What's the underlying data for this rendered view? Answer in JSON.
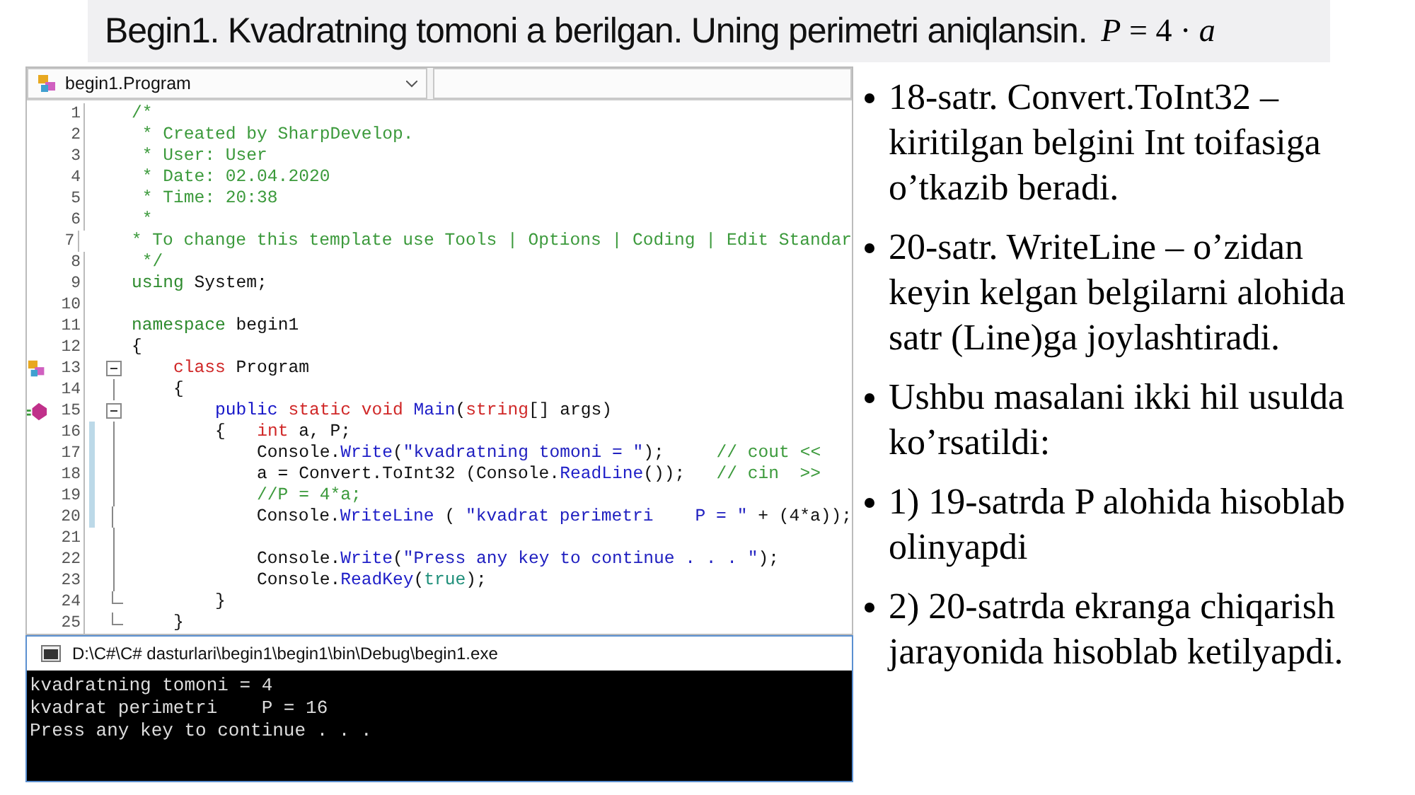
{
  "slide_title": {
    "text": "Begin1. Kvadratning tomoni a berilgan. Uning perimetri aniqlansin.",
    "formula": "*P* = 4 · *a*"
  },
  "editor": {
    "class_selector": "begin1.Program",
    "lines": [
      {
        "number": "1",
        "changed": false,
        "tokens": [
          {
            "kind": "comment",
            "text": "/*"
          }
        ]
      },
      {
        "number": "2",
        "changed": false,
        "tokens": [
          {
            "kind": "comment",
            "text": " * Created by SharpDevelop."
          }
        ]
      },
      {
        "number": "3",
        "changed": false,
        "tokens": [
          {
            "kind": "comment",
            "text": " * User: User"
          }
        ]
      },
      {
        "number": "4",
        "changed": false,
        "tokens": [
          {
            "kind": "comment",
            "text": " * Date: 02.04.2020"
          }
        ]
      },
      {
        "number": "5",
        "changed": false,
        "tokens": [
          {
            "kind": "comment",
            "text": " * Time: 20:38"
          }
        ]
      },
      {
        "number": "6",
        "changed": false,
        "tokens": [
          {
            "kind": "comment",
            "text": " *"
          }
        ]
      },
      {
        "number": "7",
        "changed": false,
        "tokens": [
          {
            "kind": "comment",
            "text": " * To change this template use Tools | Options | Coding | Edit Standar"
          }
        ]
      },
      {
        "number": "8",
        "changed": false,
        "tokens": [
          {
            "kind": "comment",
            "text": " */"
          }
        ]
      },
      {
        "number": "9",
        "changed": false,
        "tokens": [
          {
            "kind": "keyword-green",
            "text": "using"
          },
          {
            "kind": "plain",
            "text": " System;"
          }
        ]
      },
      {
        "number": "10",
        "changed": false
      },
      {
        "number": "11",
        "changed": false,
        "tokens": [
          {
            "kind": "keyword-green",
            "text": "namespace"
          },
          {
            "kind": "plain",
            "text": " begin1"
          }
        ]
      },
      {
        "number": "12",
        "changed": false,
        "tokens": [
          {
            "kind": "plain",
            "text": "{"
          }
        ],
        "children": [
          {
            "number": "13",
            "kind": "class",
            "changed": false,
            "tokens": [
              {
                "kind": "keyword-red",
                "text": "class"
              },
              {
                "kind": "plain",
                "text": " Program"
              }
            ]
          },
          {
            "number": "14",
            "kind": "code",
            "changed": false,
            "tokens": [
              {
                "kind": "plain",
                "text": "{"
              }
            ],
            "children": [
              {
                "number": "15",
                "kind": "method",
                "changed": false,
                "tokens": [
                  {
                    "kind": "keyword-blue",
                    "text": "public"
                  },
                  {
                    "kind": "keyword-red",
                    "text": " static void"
                  },
                  {
                    "kind": "method",
                    "text": " Main"
                  },
                  {
                    "kind": "plain",
                    "text": "("
                  },
                  {
                    "kind": "keyword-red",
                    "text": "string"
                  },
                  {
                    "kind": "plain",
                    "text": "[] args)"
                  }
                ]
              },
              {
                "number": "16",
                "kind": "code",
                "changed": true,
                "tokens": [
                  {
                    "kind": "plain",
                    "text": "{   "
                  },
                  {
                    "kind": "keyword-red",
                    "text": "int"
                  },
                  {
                    "kind": "plain",
                    "text": " a, P;"
                  }
                ],
                "children": [
                  {
                    "number": "17",
                    "kind": "code",
                    "changed": true,
                    "tokens": [
                      {
                        "kind": "plain",
                        "text": "Console."
                      },
                      {
                        "kind": "method",
                        "text": "Write"
                      },
                      {
                        "kind": "plain",
                        "text": "("
                      },
                      {
                        "kind": "string",
                        "text": "\"kvadratning tomoni = \""
                      },
                      {
                        "kind": "plain",
                        "text": ");     "
                      },
                      {
                        "kind": "comment",
                        "text": "// cout <<"
                      }
                    ]
                  },
                  {
                    "number": "18",
                    "kind": "code",
                    "changed": true,
                    "tokens": [
                      {
                        "kind": "plain",
                        "text": "a = Convert.ToInt32 (Console."
                      },
                      {
                        "kind": "method",
                        "text": "ReadLine"
                      },
                      {
                        "kind": "plain",
                        "text": "());   "
                      },
                      {
                        "kind": "comment",
                        "text": "// cin  >>"
                      }
                    ]
                  },
                  {
                    "number": "19",
                    "kind": "code",
                    "changed": true,
                    "tokens": [
                      {
                        "kind": "comment",
                        "text": "//P = 4*a;"
                      }
                    ]
                  },
                  {
                    "number": "20",
                    "kind": "code",
                    "changed": true,
                    "tokens": [
                      {
                        "kind": "plain",
                        "text": "Console."
                      },
                      {
                        "kind": "method",
                        "text": "WriteLine"
                      },
                      {
                        "kind": "plain",
                        "text": " ( "
                      },
                      {
                        "kind": "string",
                        "text": "\"kvadrat perimetri    P = \""
                      },
                      {
                        "kind": "plain",
                        "text": " + (4*a));"
                      }
                    ]
                  },
                  {
                    "number": "21",
                    "kind": "code",
                    "changed": false
                  },
                  {
                    "number": "22",
                    "kind": "code",
                    "changed": false,
                    "tokens": [
                      {
                        "kind": "plain",
                        "text": "Console."
                      },
                      {
                        "kind": "method",
                        "text": "Write"
                      },
                      {
                        "kind": "plain",
                        "text": "("
                      },
                      {
                        "kind": "string",
                        "text": "\"Press any key to continue . . . \""
                      },
                      {
                        "kind": "plain",
                        "text": ");"
                      }
                    ]
                  },
                  {
                    "number": "23",
                    "kind": "code",
                    "changed": false,
                    "tokens": [
                      {
                        "kind": "plain",
                        "text": "Console."
                      },
                      {
                        "kind": "method",
                        "text": "ReadKey"
                      },
                      {
                        "kind": "plain",
                        "text": "("
                      },
                      {
                        "kind": "literal",
                        "text": "true"
                      },
                      {
                        "kind": "plain",
                        "text": ");"
                      }
                    ]
                  }
                ]
              },
              {
                "number": "24",
                "kind": "end",
                "changed": false,
                "tokens": [
                  {
                    "kind": "plain",
                    "text": "}"
                  }
                ]
              }
            ]
          },
          {
            "number": "25",
            "kind": "end",
            "changed": false,
            "tokens": [
              {
                "kind": "plain",
                "text": "}"
              }
            ]
          }
        ]
      }
    ]
  },
  "console": {
    "title": "D:\\C#\\C# dasturlari\\begin1\\begin1\\bin\\Debug\\begin1.exe",
    "output": [
      "kvadratning tomoni = 4",
      "kvadrat perimetri    P = 16",
      "Press any key to continue . . ."
    ]
  },
  "bullets": [
    "18-satr. Convert.ToInt32 – kiritilgan belgini Int toifasiga o’tkazib beradi.",
    "20-satr. WriteLine – o’zidan keyin kelgan belgilarni alohida satr (Line)ga joylashtiradi.",
    "Ushbu masalani ikki hil usulda ko’rsatildi:",
    "1) 19-satrda P alohida hisoblab olinyapdi",
    "2) 20-satrda ekranga chiqarish jarayonida hisoblab ketilyapdi."
  ]
}
